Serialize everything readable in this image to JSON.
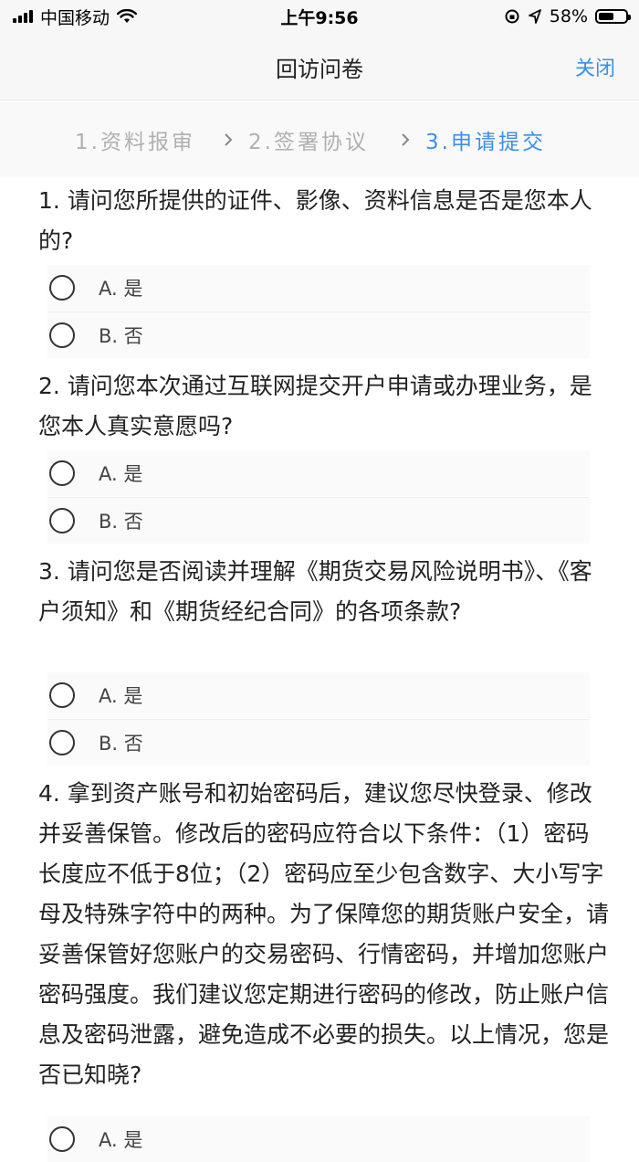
{
  "status_bar": {
    "carrier": "中国移动",
    "time": "上午9:56",
    "battery_percent": "58%",
    "battery_level": 0.58
  },
  "nav": {
    "title": "回访问卷",
    "close_label": "关闭"
  },
  "steps": [
    {
      "label": "1.资料报审"
    },
    {
      "label": "2.签署协议"
    },
    {
      "label": "3.申请提交"
    }
  ],
  "questions": [
    {
      "text": "1. 请问您所提供的证件、影像、资料信息是否是您本人的?",
      "options": [
        "A. 是",
        "B. 否"
      ]
    },
    {
      "text": "2. 请问您本次通过互联网提交开户申请或办理业务，是您本人真实意愿吗?",
      "options": [
        "A. 是",
        "B. 否"
      ]
    },
    {
      "text": "3. 请问您是否阅读并理解《期货交易风险说明书》、《客户须知》和《期货经纪合同》的各项条款?",
      "options": [
        "A. 是",
        "B. 否"
      ]
    },
    {
      "text": "4. 拿到资产账号和初始密码后，建议您尽快登录、修改并妥善保管。修改后的密码应符合以下条件：（1）密码长度应不低于8位；（2）密码应至少包含数字、大小写字母及特殊字符中的两种。为了保障您的期货账户安全，请妥善保管好您账户的交易密码、行情密码，并增加您账户密码强度。我们建议您定期进行密码的修改，防止账户信息及密码泄露，避免造成不必要的损失。以上情况，您是否已知晓?",
      "options": [
        "A. 是"
      ]
    }
  ]
}
